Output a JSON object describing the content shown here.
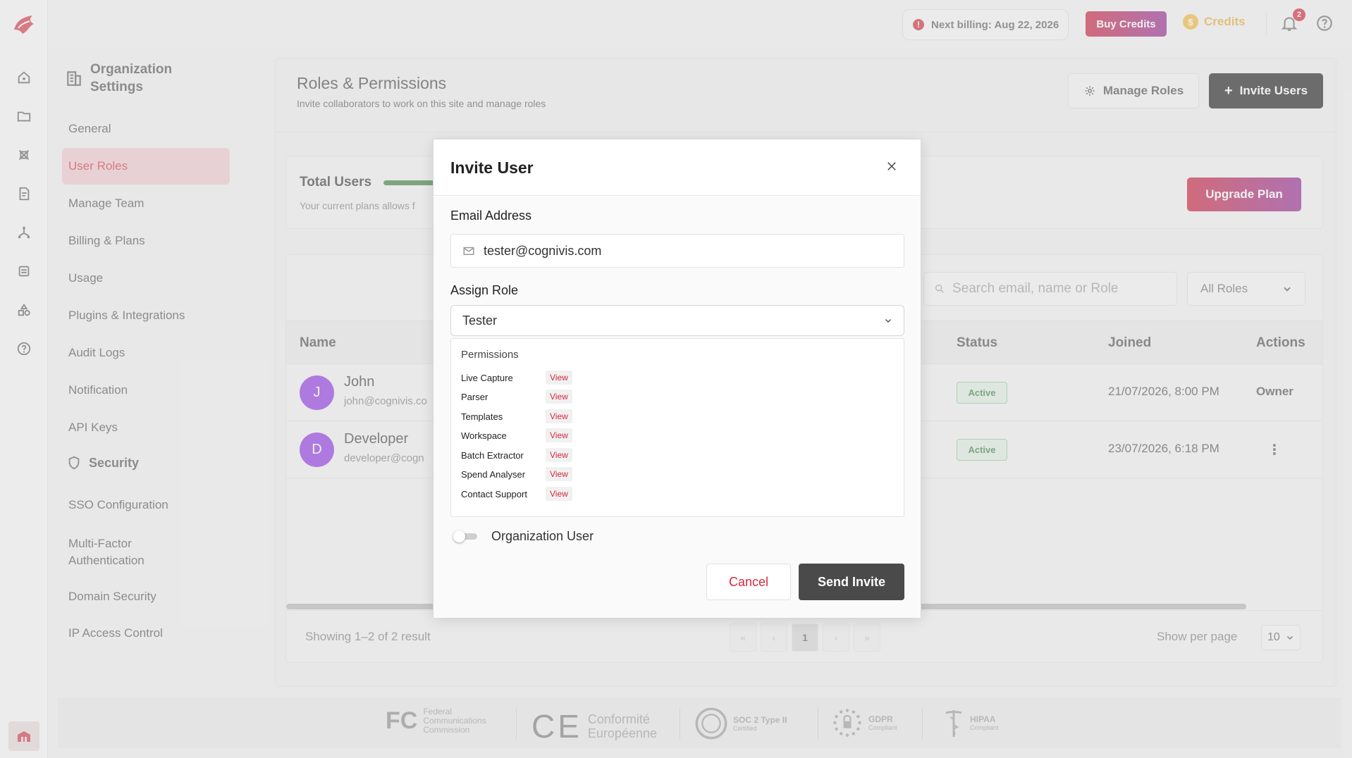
{
  "topbar": {
    "billing_text": "Next billing: Aug 22, 2026",
    "buy_credits_label": "Buy Credits",
    "credits_label": "Credits",
    "notification_count": "2"
  },
  "settings": {
    "title": "Organization Settings",
    "items": [
      {
        "label": "General"
      },
      {
        "label": "User Roles"
      },
      {
        "label": "Manage Team"
      },
      {
        "label": "Billing & Plans"
      },
      {
        "label": "Usage"
      },
      {
        "label": "Plugins & Integrations"
      },
      {
        "label": "Audit Logs"
      },
      {
        "label": "Notification"
      },
      {
        "label": "API Keys"
      }
    ],
    "security_heading": "Security",
    "security_items": [
      {
        "label": "SSO Configuration"
      },
      {
        "label": "Multi-Factor Authentication"
      },
      {
        "label": "Domain Security"
      },
      {
        "label": "IP Access Control"
      }
    ]
  },
  "main": {
    "title": "Roles & Permissions",
    "subtitle": "Invite collaborators to work on this site and manage roles",
    "manage_roles_label": "Manage Roles",
    "invite_users_label": "Invite Users",
    "total_users_label": "Total Users",
    "plan_text": "Your current plans allows f",
    "upgrade_label": "Upgrade Plan",
    "search_placeholder": "Search email, name or Role",
    "role_filter": "All Roles",
    "columns": {
      "name": "Name",
      "status": "Status",
      "joined": "Joined",
      "actions": "Actions"
    },
    "rows": [
      {
        "initial": "J",
        "name": "John",
        "email": "john@cognivis.co",
        "status": "Active",
        "joined": "21/07/2026, 8:00 PM",
        "action": "Owner"
      },
      {
        "initial": "D",
        "name": "Developer",
        "email": "developer@cogn",
        "status": "Active",
        "joined": "23/07/2026, 6:18 PM",
        "action": "⋮"
      }
    ],
    "showing": "Showing 1–2 of 2 result",
    "pager": {
      "first": "«",
      "prev": "‹",
      "current": "1",
      "next": "›",
      "last": "»"
    },
    "per_page_label": "Show per page",
    "per_page_value": "10"
  },
  "compliance": {
    "fcc_text": "Federal Communications Commission",
    "ce_text": "Conformité Européenne",
    "soc_text": "SOC 2 Type II",
    "soc_sub": "Certified",
    "gdpr_text": "GDPR",
    "gdpr_sub": "Compliant",
    "hipaa_text": "HIPAA",
    "hipaa_sub": "Compliant"
  },
  "modal": {
    "title": "Invite User",
    "email_label": "Email Address",
    "email_value": "tester@cognivis.com",
    "role_label": "Assign Role",
    "role_value": "Tester",
    "permissions_title": "Permissions",
    "permissions": [
      {
        "name": "Live Capture",
        "level": "View"
      },
      {
        "name": "Parser",
        "level": "View"
      },
      {
        "name": "Templates",
        "level": "View"
      },
      {
        "name": "Workspace",
        "level": "View"
      },
      {
        "name": "Batch Extractor",
        "level": "View"
      },
      {
        "name": "Spend Analyser",
        "level": "View"
      },
      {
        "name": "Contact Support",
        "level": "View"
      }
    ],
    "org_user_label": "Organization User",
    "org_user_enabled": false,
    "cancel_label": "Cancel",
    "send_label": "Send Invite"
  },
  "colors": {
    "brand_red": "#d22a3c",
    "brand_gradient_start": "#c8102e",
    "brand_gradient_end": "#8c1c8c",
    "active_green": "#2f7a3b",
    "avatar_purple": "#8a2be2"
  }
}
